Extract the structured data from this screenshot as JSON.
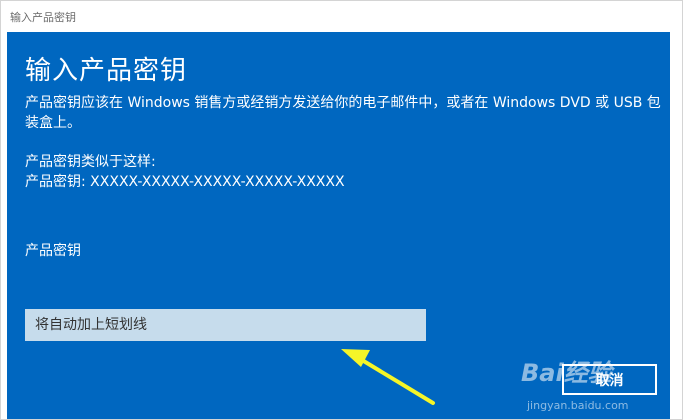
{
  "window": {
    "title": "输入产品密钥"
  },
  "dialog": {
    "heading": "输入产品密钥",
    "description": "产品密钥应该在 Windows 销售方或经销方发送给你的电子邮件中，或者在 Windows DVD 或 USB 包装盒上。",
    "example_caption": "产品密钥类似于这样:",
    "example_key": "产品密钥: XXXXX-XXXXX-XXXXX-XXXXX-XXXXX",
    "field_label": "产品密钥",
    "input": {
      "value": "",
      "placeholder": "将自动加上短划线"
    },
    "cancel_label": "取消"
  },
  "annotation": {
    "arrow_color": "#f5f528",
    "arrow_icon": "yellow-pointer-arrow-icon"
  },
  "watermark": {
    "brand": "Bai经验",
    "url": "jingyan.baidu.com"
  },
  "colors": {
    "panel_blue": "#0067c0",
    "input_fill": "#c6dcec",
    "text_white": "#ffffff"
  }
}
